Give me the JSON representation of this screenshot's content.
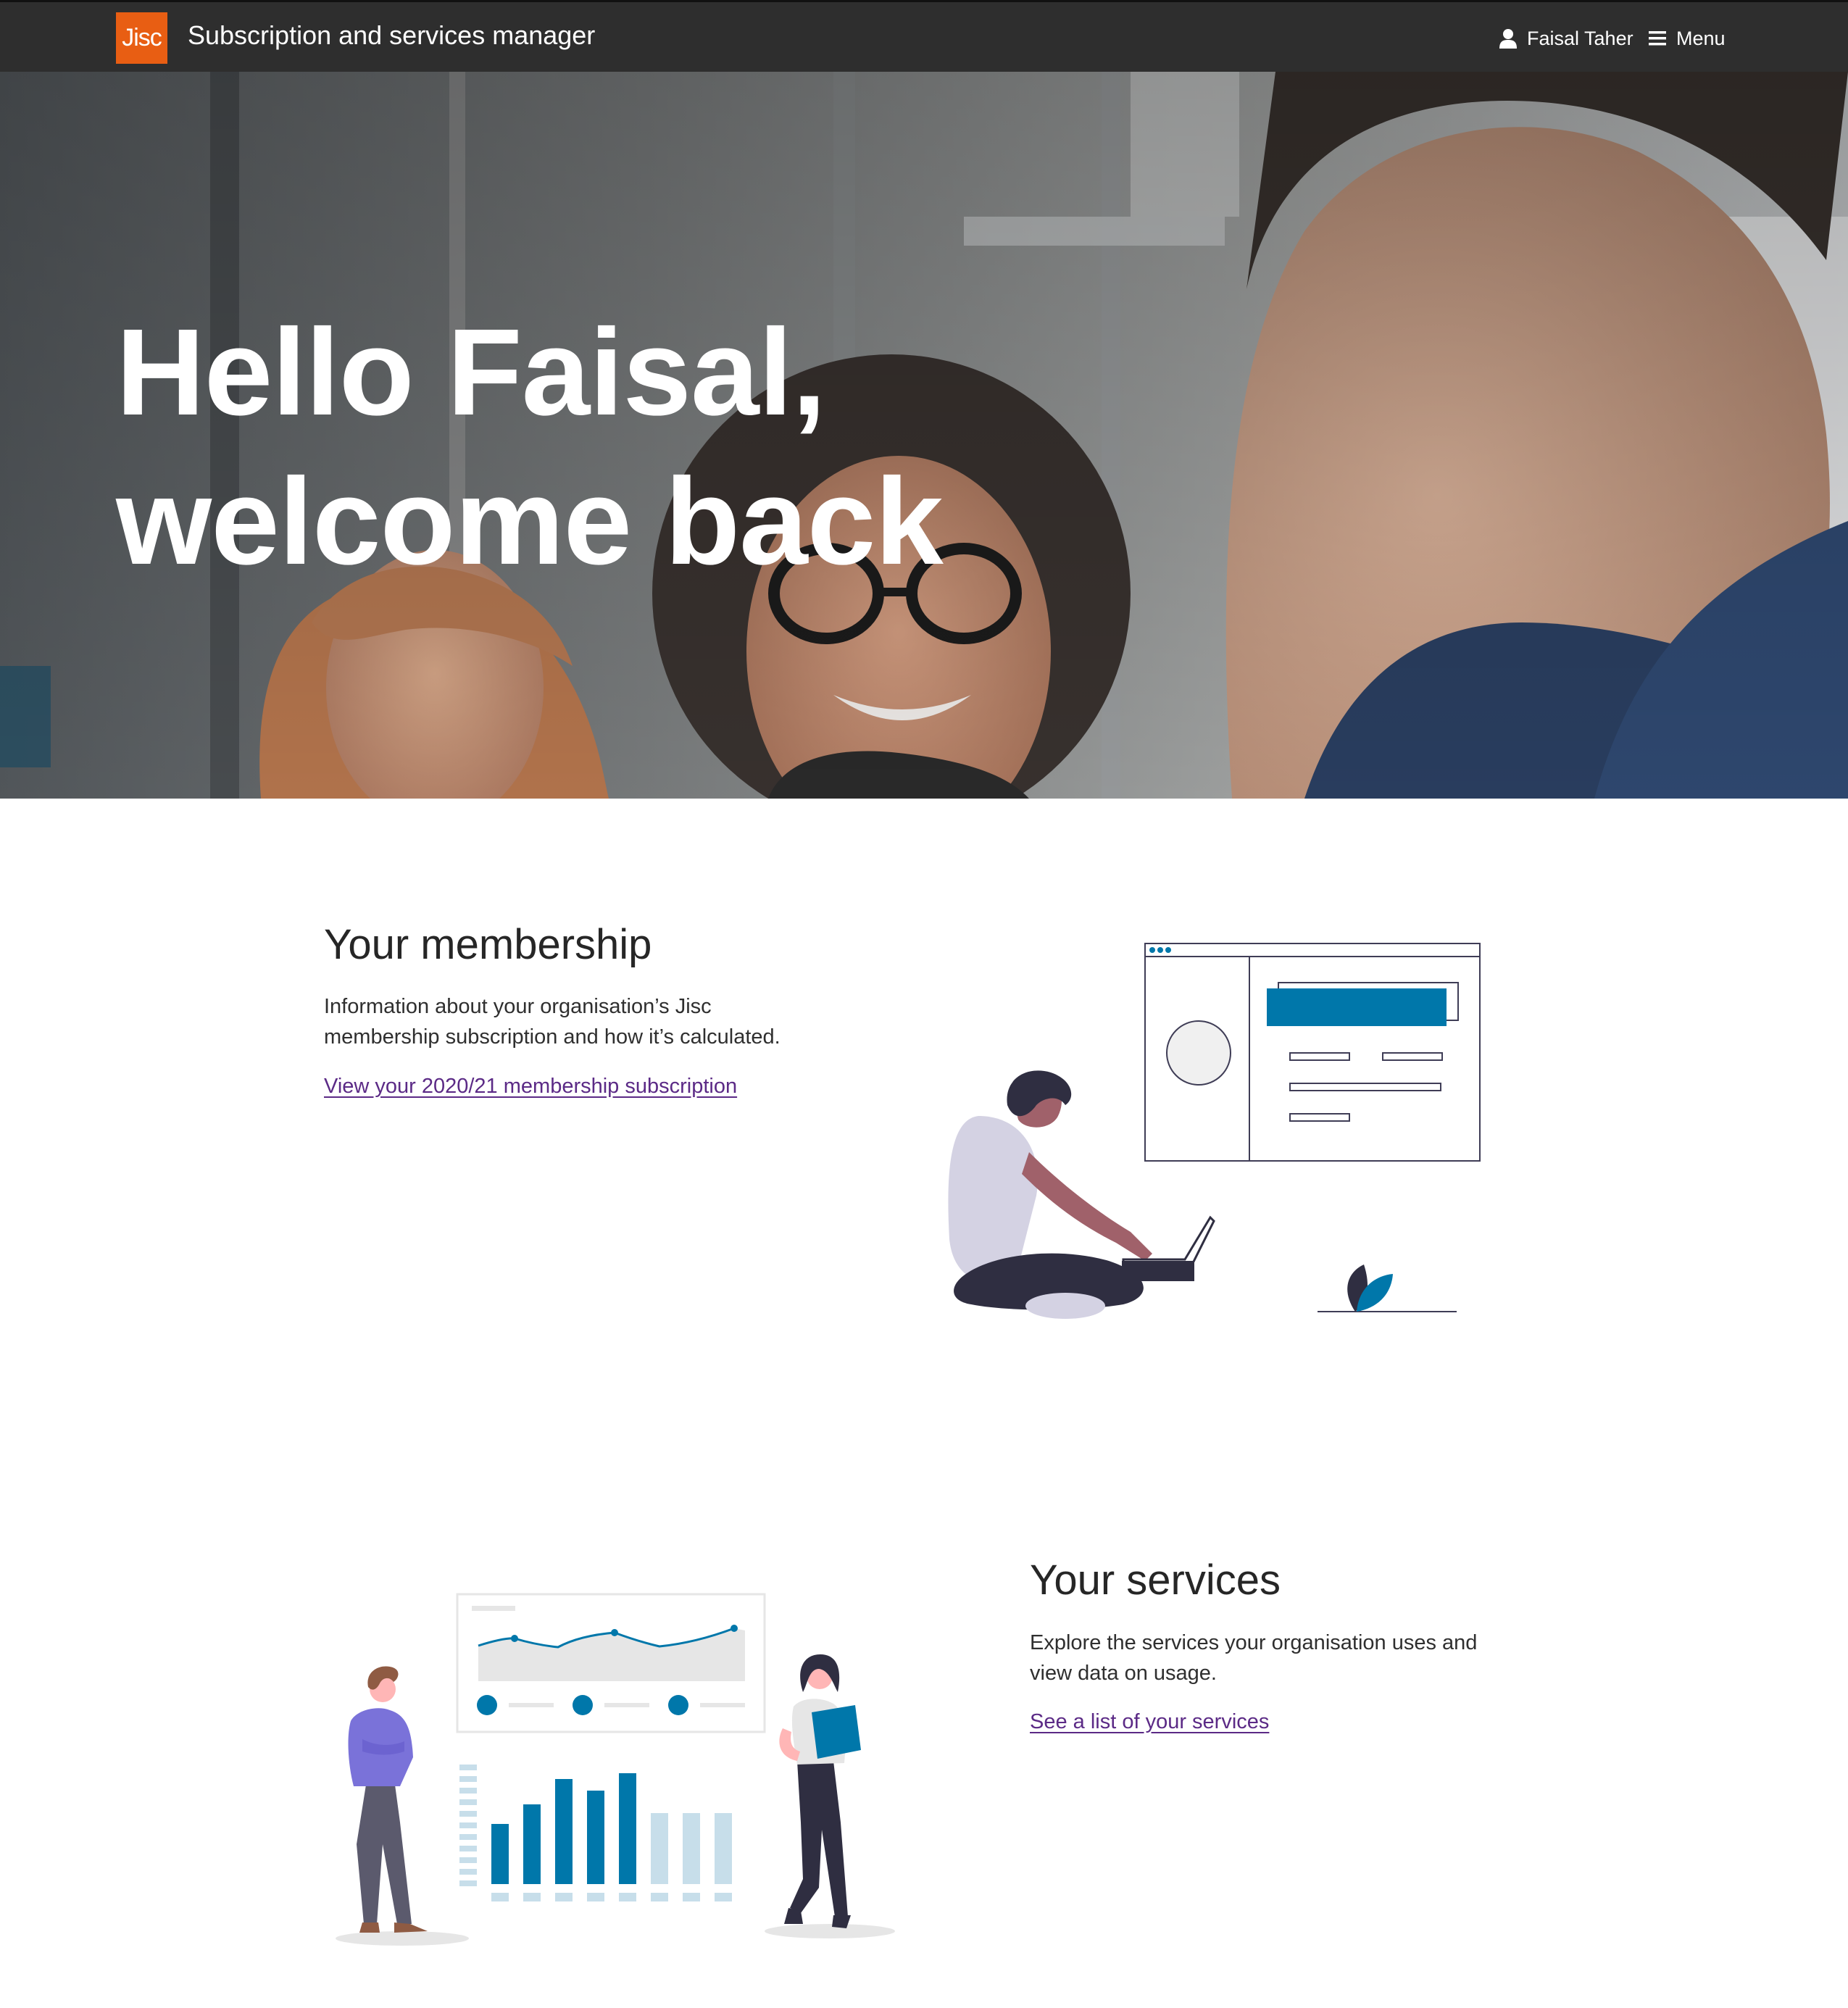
{
  "header": {
    "logo_text": "Jisc",
    "title": "Subscription and services manager",
    "user_name": "Faisal Taher",
    "menu_label": "Menu"
  },
  "hero": {
    "line1": "Hello Faisal,",
    "line2": "welcome back"
  },
  "membership": {
    "title": "Your membership",
    "desc_line1": "Information about your organisation’s Jisc",
    "desc_line2": "membership subscription and how it’s calculated.",
    "link": "View your 2020/21 membership subscription"
  },
  "services": {
    "title": "Your services",
    "desc_line1": "Explore the services your organisation uses and",
    "desc_line2": "view data on usage.",
    "link": "See a list of your services"
  },
  "colors": {
    "brand_orange": "#e85e13",
    "header_bg": "#2e2e2e",
    "accent_blue": "#0077aa",
    "link_purple": "#5b2a86"
  },
  "icons": [
    "user-icon",
    "hamburger-menu-icon"
  ]
}
